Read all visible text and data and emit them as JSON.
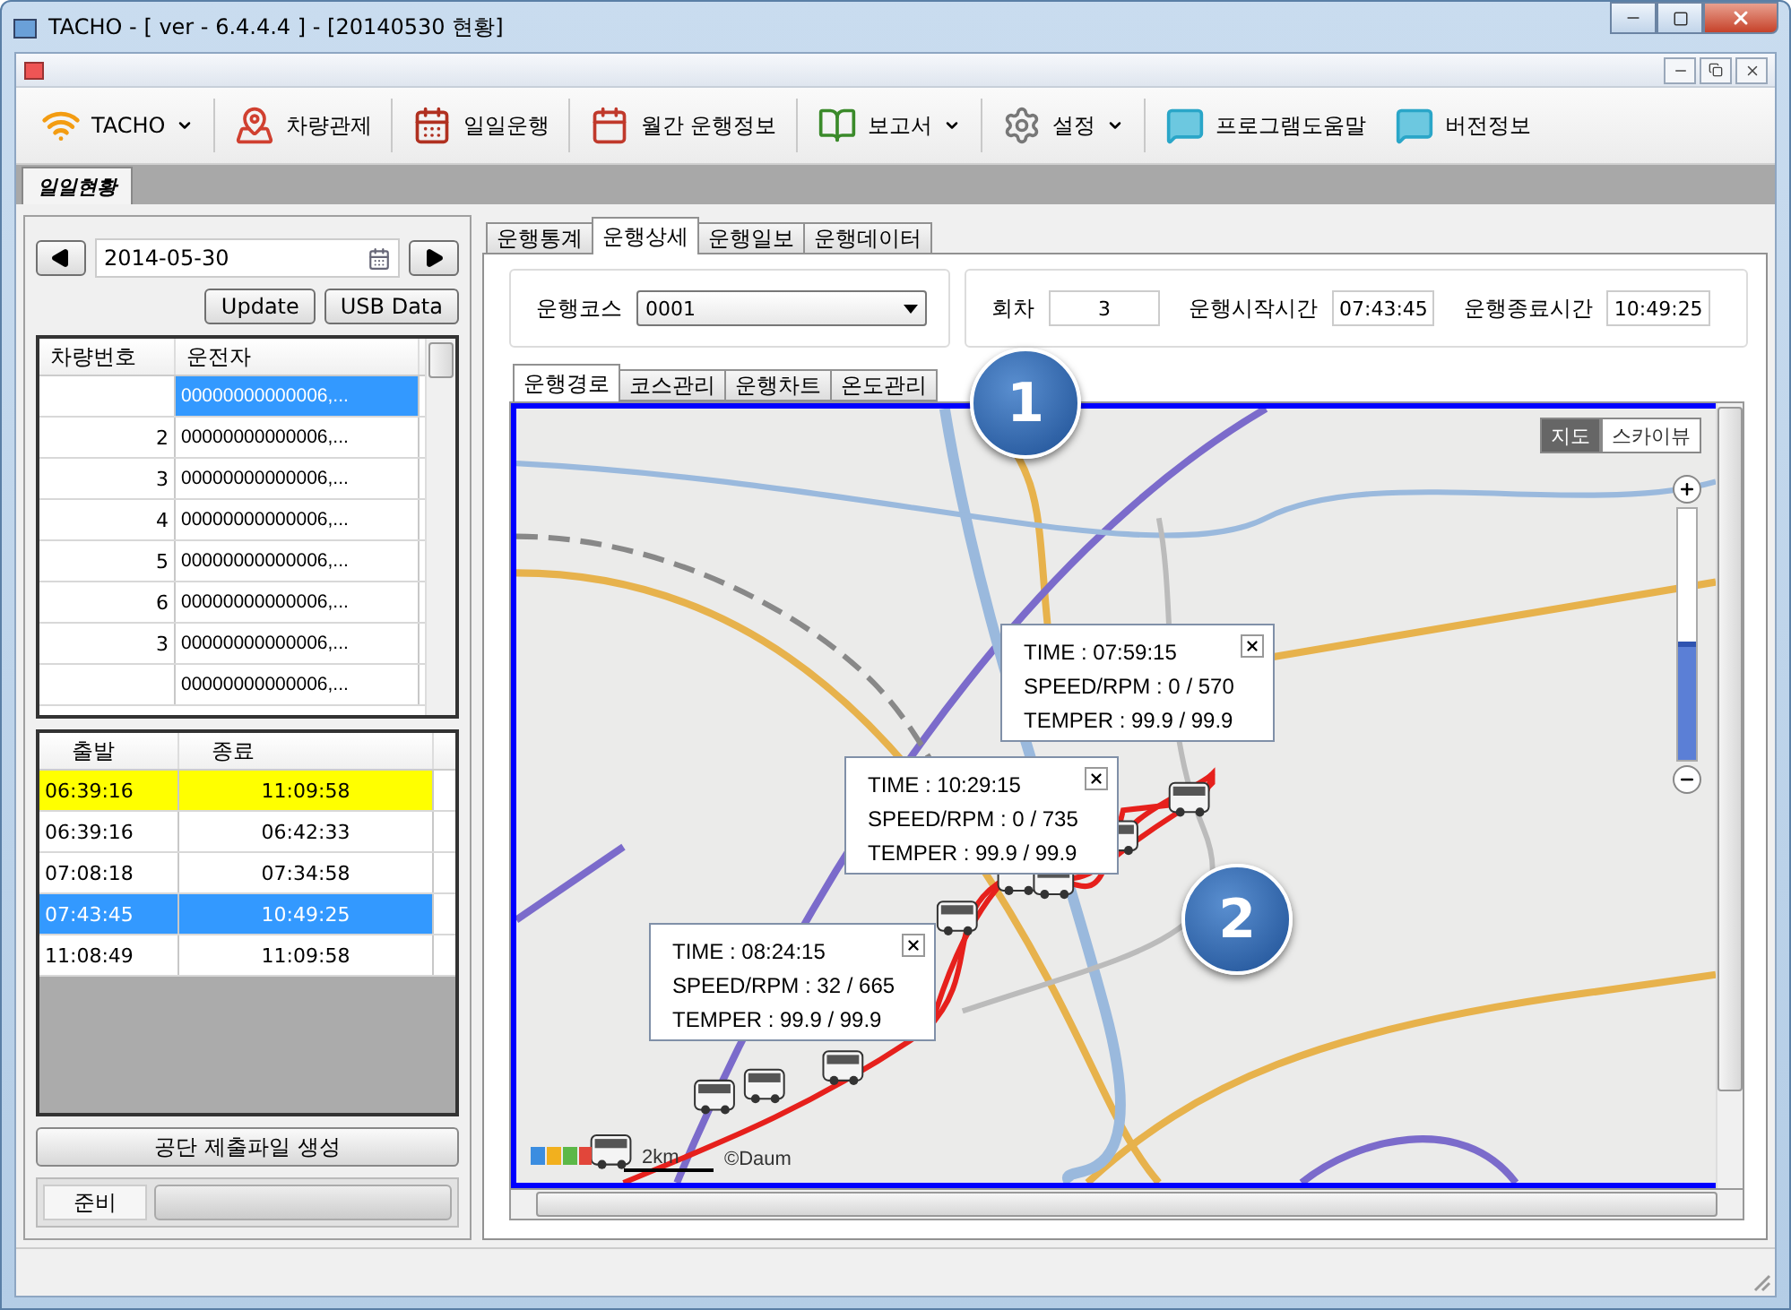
{
  "window": {
    "title": "TACHO -  [ ver - 6.4.4.4 ] - [20140530  현황]"
  },
  "toolbar": [
    {
      "kind": "wifi",
      "label": "TACHO",
      "dropdown": true
    },
    {
      "kind": "map",
      "label": "차량관제",
      "dropdown": false
    },
    {
      "kind": "calendar",
      "label": "일일운행",
      "dropdown": false
    },
    {
      "kind": "calendar-month",
      "label": "월간 운행정보",
      "dropdown": false
    },
    {
      "kind": "book",
      "label": "보고서",
      "dropdown": true
    },
    {
      "kind": "gear",
      "label": "설정",
      "dropdown": true
    },
    {
      "kind": "help",
      "label": "프로그램도움말",
      "dropdown": false
    },
    {
      "kind": "help",
      "label": "버전정보",
      "dropdown": false
    }
  ],
  "doc_tabs": [
    {
      "label": "일일현황",
      "selected": true
    }
  ],
  "left_panel": {
    "date": "2014-05-30",
    "buttons": [
      "Update",
      "USB Data"
    ],
    "vehicle_table": {
      "columns": [
        "차량번호",
        "운전자"
      ],
      "rows": [
        {
          "driver": "00000000000006,...",
          "selected": true
        },
        {
          "vehicle": "2",
          "driver": "00000000000006,...",
          "selected": false
        },
        {
          "vehicle": "3",
          "driver": "00000000000006,...",
          "selected": false
        },
        {
          "vehicle": "4",
          "driver": "00000000000006,...",
          "selected": false
        },
        {
          "vehicle": "5",
          "driver": "00000000000006,...",
          "selected": false
        },
        {
          "vehicle": "6",
          "driver": "00000000000006,...",
          "selected": false
        },
        {
          "vehicle": "3",
          "driver": "00000000000006,...",
          "selected": false
        },
        {
          "driver": "00000000000006,...",
          "selected": false
        }
      ]
    },
    "trip_table": {
      "columns": [
        "출발",
        "종료"
      ],
      "rows": [
        {
          "start": "06:39:16",
          "end": "11:09:58",
          "highlighted": true,
          "selected": false
        },
        {
          "start": "06:39:16",
          "end": "06:42:33",
          "highlighted": false,
          "selected": false
        },
        {
          "start": "07:08:18",
          "end": "07:34:58",
          "highlighted": false,
          "selected": false
        },
        {
          "start": "07:43:45",
          "end": "10:49:25",
          "highlighted": false,
          "selected": true
        },
        {
          "start": "11:08:49",
          "end": "11:09:58",
          "highlighted": false,
          "selected": false
        }
      ]
    },
    "generate_button": "공단 제출파일 생성",
    "status": {
      "text": "준비",
      "level": 0
    }
  },
  "main_tabs": [
    {
      "label": "운행통계",
      "selected": false
    },
    {
      "label": "운행상세",
      "selected": true
    },
    {
      "label": "운행일보",
      "selected": false
    },
    {
      "label": "운행데이터",
      "selected": false
    }
  ],
  "course": {
    "label": "운행코스",
    "value": "0001"
  },
  "trip_fields": [
    {
      "label": "회차",
      "value": "3"
    },
    {
      "label": "운행시작시간",
      "value": "07:43:45"
    },
    {
      "label": "운행종료시간",
      "value": "10:49:25"
    }
  ],
  "sub_tabs": [
    {
      "label": "운행경로",
      "selected": true
    },
    {
      "label": "코스관리",
      "selected": false
    },
    {
      "label": "운행차트",
      "selected": false
    },
    {
      "label": "온도관리",
      "selected": false
    }
  ],
  "map": {
    "map_types": [
      {
        "label": "지도",
        "selected": true
      },
      {
        "label": "스카이뷰",
        "selected": false
      }
    ],
    "zoom": {
      "level": 0.47
    },
    "popups": [
      {
        "lines": [
          "TIME : 07:59:15",
          "SPEED/RPM : 0 / 570",
          "TEMPER : 99.9 / 99.9"
        ]
      },
      {
        "lines": [
          "TIME : 10:29:15",
          "SPEED/RPM : 0 / 735",
          "TEMPER : 99.9 / 99.9"
        ]
      },
      {
        "lines": [
          "TIME : 08:24:15",
          "SPEED/RPM : 32 / 665",
          "TEMPER : 99.9 / 99.9"
        ]
      }
    ],
    "scale": "2km",
    "copyright": "©Daum"
  },
  "callouts": [
    "1",
    "2"
  ]
}
